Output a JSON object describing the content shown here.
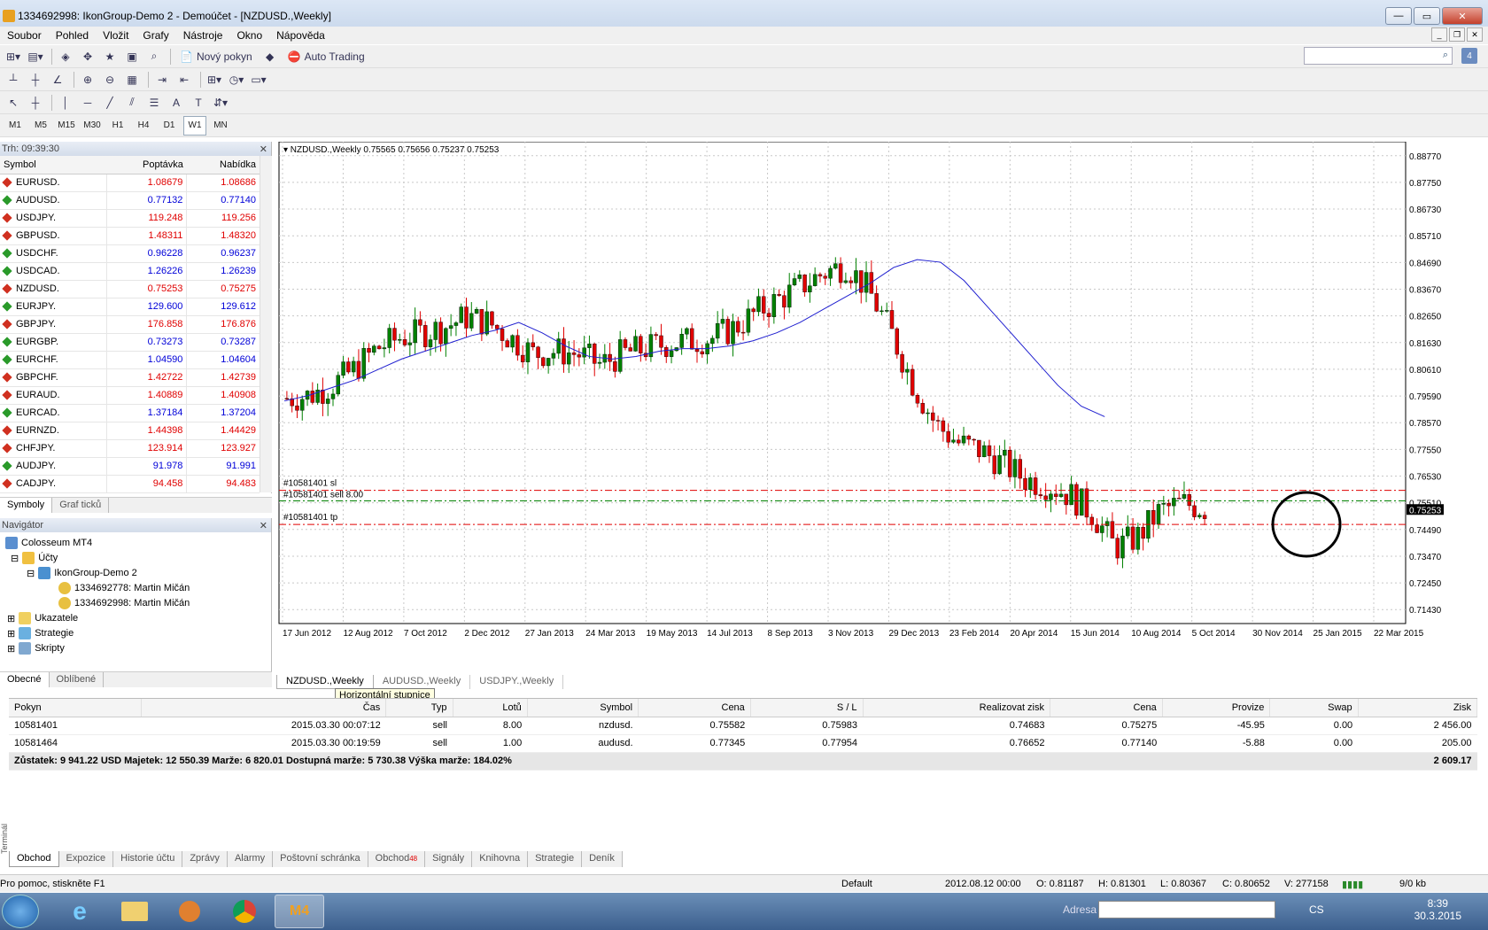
{
  "window": {
    "title": "1334692998: IkonGroup-Demo 2 - Demoúčet - [NZDUSD.,Weekly]"
  },
  "menu": [
    "Soubor",
    "Pohled",
    "Vložit",
    "Grafy",
    "Nástroje",
    "Okno",
    "Nápověda"
  ],
  "toolbar": {
    "new_order": "Nový pokyn",
    "auto_trading": "Auto Trading"
  },
  "timeframes": [
    "M1",
    "M5",
    "M15",
    "M30",
    "H1",
    "H4",
    "D1",
    "W1",
    "MN"
  ],
  "market_watch": {
    "header": "Trh: 09:39:30",
    "columns": [
      "Symbol",
      "Poptávka",
      "Nabídka"
    ],
    "rows": [
      {
        "symbol": "EURUSD.",
        "bid": "1.08679",
        "ask": "1.08686",
        "dir": "dn"
      },
      {
        "symbol": "AUDUSD.",
        "bid": "0.77132",
        "ask": "0.77140",
        "dir": "up"
      },
      {
        "symbol": "USDJPY.",
        "bid": "119.248",
        "ask": "119.256",
        "dir": "dn"
      },
      {
        "symbol": "GBPUSD.",
        "bid": "1.48311",
        "ask": "1.48320",
        "dir": "dn"
      },
      {
        "symbol": "USDCHF.",
        "bid": "0.96228",
        "ask": "0.96237",
        "dir": "up"
      },
      {
        "symbol": "USDCAD.",
        "bid": "1.26226",
        "ask": "1.26239",
        "dir": "up"
      },
      {
        "symbol": "NZDUSD.",
        "bid": "0.75253",
        "ask": "0.75275",
        "dir": "dn"
      },
      {
        "symbol": "EURJPY.",
        "bid": "129.600",
        "ask": "129.612",
        "dir": "up"
      },
      {
        "symbol": "GBPJPY.",
        "bid": "176.858",
        "ask": "176.876",
        "dir": "dn"
      },
      {
        "symbol": "EURGBP.",
        "bid": "0.73273",
        "ask": "0.73287",
        "dir": "up"
      },
      {
        "symbol": "EURCHF.",
        "bid": "1.04590",
        "ask": "1.04604",
        "dir": "up"
      },
      {
        "symbol": "GBPCHF.",
        "bid": "1.42722",
        "ask": "1.42739",
        "dir": "dn"
      },
      {
        "symbol": "EURAUD.",
        "bid": "1.40889",
        "ask": "1.40908",
        "dir": "dn"
      },
      {
        "symbol": "EURCAD.",
        "bid": "1.37184",
        "ask": "1.37204",
        "dir": "up"
      },
      {
        "symbol": "EURNZD.",
        "bid": "1.44398",
        "ask": "1.44429",
        "dir": "dn"
      },
      {
        "symbol": "CHFJPY.",
        "bid": "123.914",
        "ask": "123.927",
        "dir": "dn"
      },
      {
        "symbol": "AUDJPY.",
        "bid": "91.978",
        "ask": "91.991",
        "dir": "up"
      },
      {
        "symbol": "CADJPY.",
        "bid": "94.458",
        "ask": "94.483",
        "dir": "dn"
      }
    ],
    "tabs": [
      "Symboly",
      "Graf ticků"
    ]
  },
  "navigator": {
    "header": "Navigátor",
    "root": "Colosseum MT4",
    "accounts": "Účty",
    "server": "IkonGroup-Demo 2",
    "account1": "1334692778: Martin Mičán",
    "account2": "1334692998: Martin Mičán",
    "indicators": "Ukazatele",
    "strategies": "Strategie",
    "scripts": "Skripty",
    "tabs": [
      "Obecné",
      "Oblíbené"
    ]
  },
  "chart": {
    "header": "NZDUSD.,Weekly  0.75565 0.75656 0.75237 0.75253",
    "tabs": [
      "NZDUSD.,Weekly",
      "AUDUSD.,Weekly",
      "USDJPY.,Weekly"
    ],
    "tooltip": "Horizontální stupnice",
    "current_price_label": "0.75253",
    "order_lines": {
      "sl": "#10581401 sl",
      "sell": "#10581401 sell 8.00",
      "tp": "#10581401 tp"
    },
    "colors": {
      "bull": "#008000",
      "bear": "#e00000",
      "ma": "#2020d0",
      "sltp": "#e00000",
      "entry": "#008000"
    }
  },
  "chart_data": {
    "type": "candlestick",
    "title": "NZDUSD.,Weekly",
    "y_ticks": [
      "0.88770",
      "0.87750",
      "0.86730",
      "0.85710",
      "0.84690",
      "0.83670",
      "0.82650",
      "0.81630",
      "0.80610",
      "0.79590",
      "0.78570",
      "0.77550",
      "0.76530",
      "0.75510",
      "0.74490",
      "0.73470",
      "0.72450",
      "0.71430"
    ],
    "ylim": [
      0.711,
      0.891
    ],
    "x_ticks": [
      "17 Jun 2012",
      "12 Aug 2012",
      "7 Oct 2012",
      "2 Dec 2012",
      "27 Jan 2013",
      "24 Mar 2013",
      "19 May 2013",
      "14 Jul 2013",
      "8 Sep 2013",
      "3 Nov 2013",
      "29 Dec 2013",
      "23 Feb 2014",
      "20 Apr 2014",
      "15 Jun 2014",
      "10 Aug 2014",
      "5 Oct 2014",
      "30 Nov 2014",
      "25 Jan 2015",
      "22 Mar 2015"
    ],
    "levels": {
      "sl": 0.75983,
      "entry": 0.75582,
      "tp": 0.74683
    },
    "trend": [
      0.795,
      0.796,
      0.8,
      0.806,
      0.814,
      0.818,
      0.82,
      0.822,
      0.826,
      0.824,
      0.818,
      0.812,
      0.813,
      0.812,
      0.808,
      0.812,
      0.814,
      0.816,
      0.817,
      0.818,
      0.822,
      0.828,
      0.833,
      0.838,
      0.843,
      0.846,
      0.836,
      0.82,
      0.8,
      0.785,
      0.778,
      0.775,
      0.77,
      0.764,
      0.762,
      0.758,
      0.751,
      0.738,
      0.742,
      0.752,
      0.755,
      0.753
    ],
    "ma": [
      0.794,
      0.796,
      0.799,
      0.802,
      0.806,
      0.81,
      0.813,
      0.816,
      0.819,
      0.821,
      0.824,
      0.82,
      0.815,
      0.811,
      0.81,
      0.811,
      0.813,
      0.814,
      0.814,
      0.815,
      0.817,
      0.82,
      0.824,
      0.829,
      0.834,
      0.839,
      0.845,
      0.848,
      0.847,
      0.84,
      0.83,
      0.82,
      0.81,
      0.8,
      0.792,
      0.788
    ]
  },
  "orders": {
    "columns": [
      "Pokyn",
      "Čas",
      "Typ",
      "Lotů",
      "Symbol",
      "Cena",
      "S / L",
      "Realizovat zisk",
      "Cena",
      "Provize",
      "Swap",
      "Zisk"
    ],
    "rows": [
      [
        "10581401",
        "2015.03.30 00:07:12",
        "sell",
        "8.00",
        "nzdusd.",
        "0.75582",
        "0.75983",
        "0.74683",
        "0.75275",
        "-45.95",
        "0.00",
        "2 456.00"
      ],
      [
        "10581464",
        "2015.03.30 00:19:59",
        "sell",
        "1.00",
        "audusd.",
        "0.77345",
        "0.77954",
        "0.76652",
        "0.77140",
        "-5.88",
        "0.00",
        "205.00"
      ]
    ],
    "summary": "Zůstatek: 9 941.22 USD  Majetek: 12 550.39  Marže: 6 820.01  Dostupná marže: 5 730.38  Výška marže: 184.02%",
    "summary_profit": "2 609.17"
  },
  "terminal": {
    "label": "Terminál",
    "tabs": [
      "Obchod",
      "Expozice",
      "Historie účtu",
      "Zprávy",
      "Alarmy",
      "Poštovní schránka",
      "Obchod",
      "Signály",
      "Knihovna",
      "Strategie",
      "Deník"
    ],
    "badge": "48"
  },
  "status": {
    "help": "Pro pomoc, stiskněte F1",
    "profile": "Default",
    "datetime": "2012.08.12 00:00",
    "open": "O: 0.81187",
    "high": "H: 0.81301",
    "low": "L: 0.80367",
    "close": "C: 0.80652",
    "volume": "V: 277158",
    "traffic": "9/0 kb"
  },
  "taskbar": {
    "address_label": "Adresa",
    "lang": "CS",
    "time": "8:39",
    "date": "30.3.2015"
  }
}
